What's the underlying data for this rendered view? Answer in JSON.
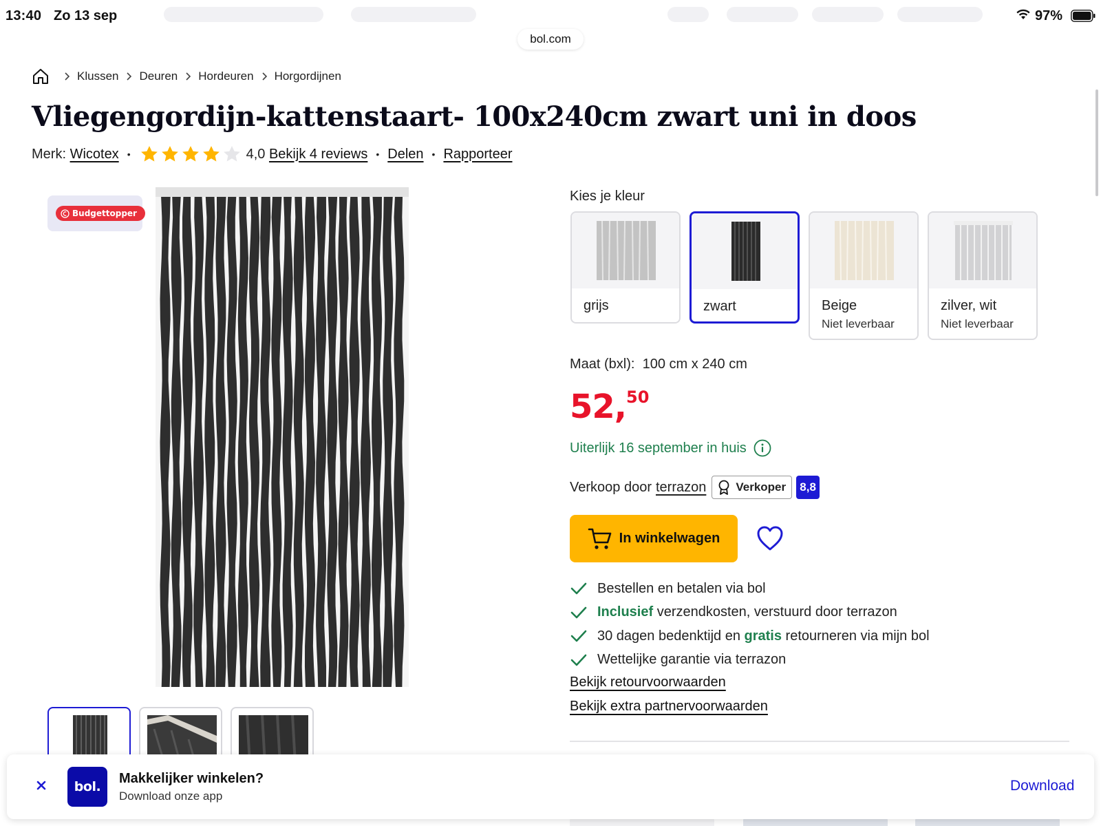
{
  "status_bar": {
    "time": "13:40",
    "date": "Zo 13 sep",
    "battery": "97%"
  },
  "browser": {
    "url": "bol.com"
  },
  "breadcrumb": {
    "items": [
      "Klussen",
      "Deuren",
      "Hordeuren",
      "Horgordijnen"
    ]
  },
  "product": {
    "title": "Vliegengordijn-kattenstaart- 100x240cm zwart uni in doos",
    "brand_label": "Merk:",
    "brand": "Wicotex",
    "rating": 4.0,
    "rating_text": "4,0",
    "reviews_link": "Bekijk 4 reviews",
    "share_link": "Delen",
    "report_link": "Rapporteer",
    "badge": "Budgettopper"
  },
  "color_picker": {
    "label": "Kies je kleur",
    "options": [
      {
        "name": "grijs",
        "sub": "",
        "selected": false,
        "color": "#b9b9b9"
      },
      {
        "name": "zwart",
        "sub": "",
        "selected": true,
        "color": "#2b2b2b"
      },
      {
        "name": "Beige",
        "sub": "Niet leverbaar",
        "selected": false,
        "color": "#ece4d4"
      },
      {
        "name": "zilver, wit",
        "sub": "Niet leverbaar",
        "selected": false,
        "color": "#c6c6c8"
      }
    ]
  },
  "size": {
    "label": "Maat (bxl):",
    "value": "100 cm x 240 cm"
  },
  "price": {
    "whole": "52,",
    "cents": "50",
    "color": "#e8132a"
  },
  "delivery": {
    "text": "Uiterlijk 16 september in huis",
    "color": "#1e7f4d"
  },
  "seller": {
    "prefix": "Verkoop door",
    "name": "terrazon",
    "tag": "Verkoper",
    "score": "8,8"
  },
  "actions": {
    "cart_label": "In winkelwagen",
    "cart_color": "#ffb500",
    "favorite": "heart-icon"
  },
  "usps": [
    {
      "pre": "Bestellen en betalen via bol",
      "bold": "",
      "post": ""
    },
    {
      "pre": "",
      "bold": "Inclusief",
      "post": " verzendkosten, verstuurd door terrazon"
    },
    {
      "pre": "30 dagen bedenktijd en ",
      "bold": "gratis",
      "post": " retourneren via mijn bol"
    },
    {
      "pre": "Wettelijke garantie via terrazon",
      "bold": "",
      "post": ""
    }
  ],
  "links": {
    "returns": "Bekijk retourvoorwaarden",
    "partner": "Bekijk extra partnervoorwaarden"
  },
  "app_banner": {
    "logo": "bol.",
    "title": "Makkelijker winkelen?",
    "subtitle": "Download onze app",
    "download": "Download",
    "brand_color": "#0b0ba8",
    "accent_color": "#1d1bd4"
  }
}
